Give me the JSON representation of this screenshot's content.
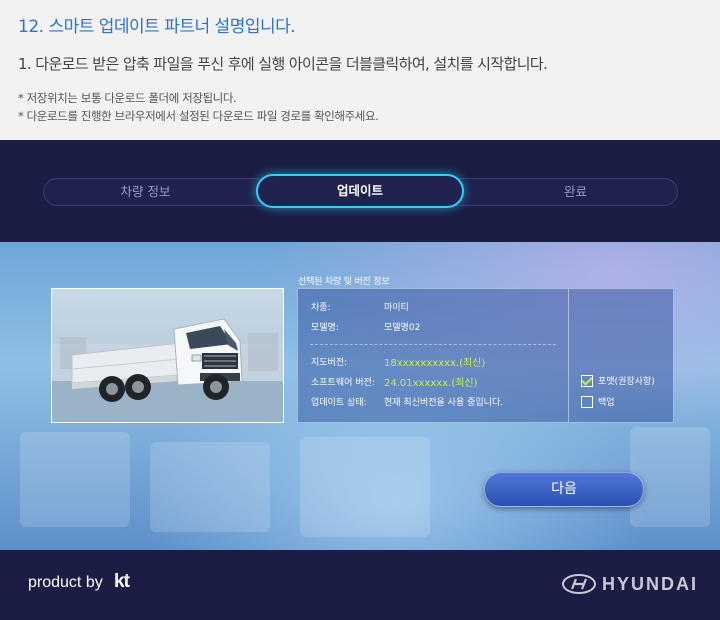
{
  "guide": {
    "title": "12. 스마트 업데이트 파트너 설명입니다.",
    "step": "1. 다운로드 받은 압축 파일을 푸신 후에 실행 아이콘을 더블클릭하여, 설치를 시작합니다.",
    "notes": [
      "* 저장위치는 보통 다운로드 폴더에 저장됩니다.",
      "* 다운로드를 진행한 브라우저에서 설정된 다운로드 파일 경로를 확인해주세요."
    ]
  },
  "tabs": [
    {
      "label": "차량 정보",
      "active": false
    },
    {
      "label": "업데이트",
      "active": true
    },
    {
      "label": "완료",
      "active": false
    }
  ],
  "info": {
    "caption": "선택된 차량 및 버전 정보",
    "vehicle_type_label": "차종:",
    "vehicle_type_value": "마이티",
    "model_label": "모델명:",
    "model_value": "모델명02",
    "map_version_label": "지도버전:",
    "map_version_value": "18xxxxxxxxxx.(최신)",
    "sw_version_label": "소프트웨어 버전:",
    "sw_version_value": "24.01xxxxxx.(최신)",
    "update_status_label": "업데이트 상태:",
    "update_status_value": "현재 최신버전을 사용 중입니다."
  },
  "options": {
    "format_label": "포맷(권장사항)",
    "format_checked": true,
    "backup_label": "백업",
    "backup_checked": false
  },
  "next_button": "다음",
  "footer": {
    "product_by": "product by",
    "kt_logo": "kt",
    "hyundai": "HYUNDAI"
  },
  "colors": {
    "accent": "#33d0f5",
    "title_blue": "#2c73c8",
    "highlight_green": "#c6f04a",
    "app_bg": "#1b1d44"
  },
  "icons": {
    "photo": "truck-photo",
    "hyundai": "hyundai-logo-icon"
  }
}
